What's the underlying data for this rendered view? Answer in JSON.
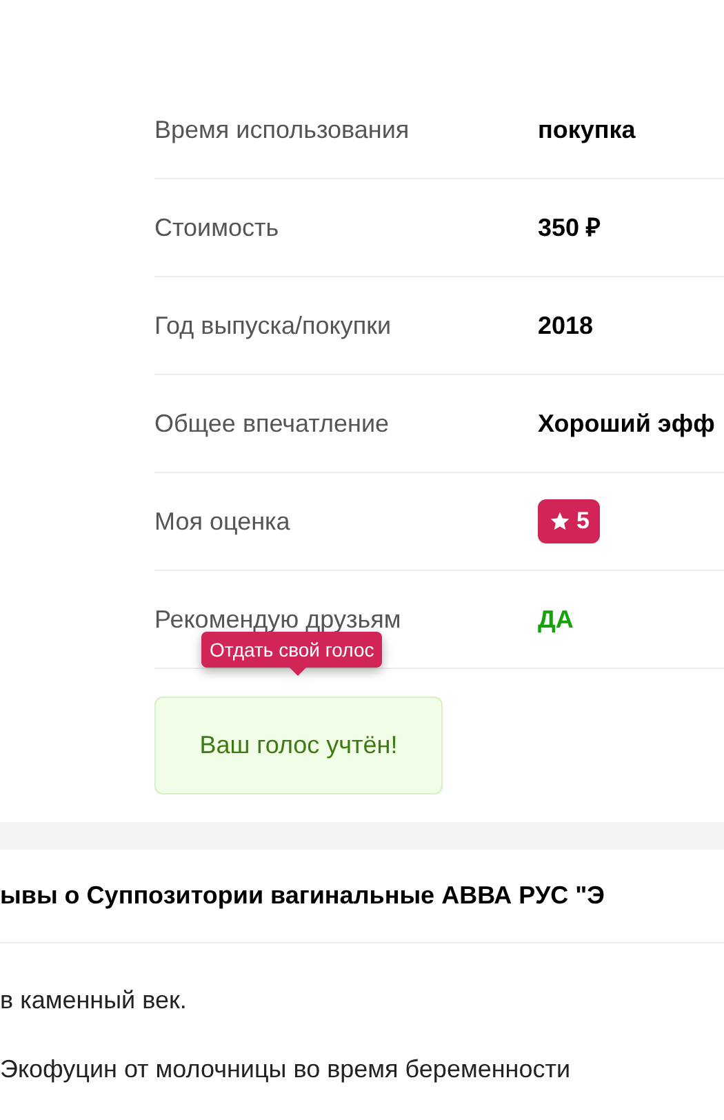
{
  "specs": [
    {
      "label": "Время использования",
      "value": "покупка",
      "kind": "text"
    },
    {
      "label": "Стоимость",
      "value": "350 ₽",
      "kind": "text"
    },
    {
      "label": "Год выпуска/покупки",
      "value": "2018",
      "kind": "text"
    },
    {
      "label": "Общее впечатление",
      "value": "Хороший эфф",
      "kind": "text"
    },
    {
      "label": "Моя оценка",
      "value": "5",
      "kind": "rating"
    },
    {
      "label": "Рекомендую друзьям",
      "value": "ДА",
      "kind": "yes"
    }
  ],
  "vote": {
    "tooltip": "Отдать свой голос",
    "message": "Ваш голос учтён!"
  },
  "reviews": {
    "heading": "ывы о Суппозитории вагинальные АВВА РУС \"Э",
    "items": [
      "в каменный век.",
      "Экофуцин от молочницы во время беременности"
    ]
  }
}
